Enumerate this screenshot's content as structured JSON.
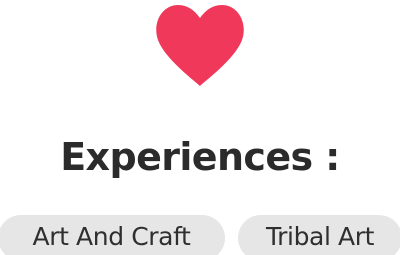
{
  "favorite": {
    "icon": "heart-icon",
    "color": "#f0385a"
  },
  "experiences": {
    "heading": "Experiences :",
    "chips": [
      {
        "label": "Art And Craft"
      },
      {
        "label": "Tribal Art"
      }
    ],
    "chip_background": "#e6e6e6",
    "heading_color": "#2b2b2b"
  }
}
